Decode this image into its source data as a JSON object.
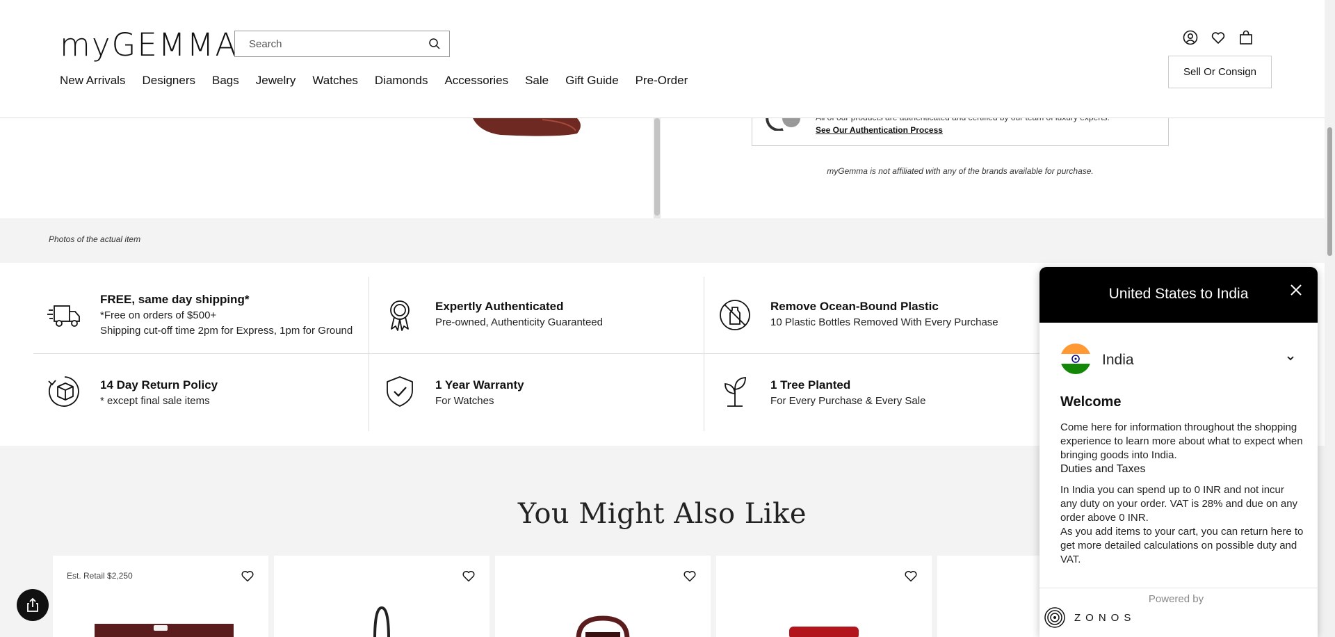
{
  "header": {
    "logo": "myGEMMA",
    "search_placeholder": "Search",
    "nav": [
      "New Arrivals",
      "Designers",
      "Bags",
      "Jewelry",
      "Watches",
      "Diamonds",
      "Accessories",
      "Sale",
      "Gift Guide",
      "Pre-Order"
    ],
    "icons": [
      "account-icon",
      "wishlist-heart-icon",
      "shopping-bag-icon"
    ],
    "sell_button": "Sell Or Consign"
  },
  "product": {
    "auth_text": "All of our products are authenticated and certified by our team of luxury experts.",
    "auth_link": "See Our Authentication Process",
    "affiliation_note": "myGemma is not affiliated with any of the brands available for purchase.",
    "photos_note": "Photos of the actual item"
  },
  "features": [
    {
      "icon": "truck-icon",
      "title": "FREE, same day shipping*",
      "lines": [
        "*Free on orders of $500+",
        "Shipping cut-off time 2pm for Express, 1pm for Ground"
      ]
    },
    {
      "icon": "ribbon-award-icon",
      "title": "Expertly Authenticated",
      "lines": [
        "Pre-owned, Authenticity Guaranteed"
      ]
    },
    {
      "icon": "no-plastic-bottle-icon",
      "title": "Remove Ocean-Bound Plastic",
      "lines": [
        "10 Plastic Bottles Removed With Every Purchase"
      ]
    },
    {
      "icon": "return-box-icon",
      "title": "14 Day Return Policy",
      "lines": [
        "* except final sale items"
      ]
    },
    {
      "icon": "shield-check-icon",
      "title": "1 Year Warranty",
      "lines": [
        "For Watches"
      ]
    },
    {
      "icon": "sprout-icon",
      "title": "1 Tree Planted",
      "lines": [
        "For Every Purchase & Every Sale"
      ]
    }
  ],
  "recommendations": {
    "heading": "You Might Also Like",
    "cards": [
      {
        "retail": "Est. Retail $2,250"
      },
      {
        "retail": ""
      },
      {
        "retail": ""
      },
      {
        "retail": ""
      },
      {
        "retail": ""
      }
    ]
  },
  "popup": {
    "title": "United States to India",
    "country": "India",
    "welcome": "Welcome",
    "welcome_text": "Come here for information throughout the shopping experience to learn more about what to expect when bringing goods into India.",
    "duties_heading": "Duties and Taxes",
    "duties_text": "In India you can spend up to 0 INR and not incur any duty on your order. VAT is 28% and due on any order above 0 INR.",
    "cart_text": "As you add items to your cart, you can return here to get more detailed calculations on possible duty and VAT.",
    "powered_by": "Powered by",
    "brand": "ZONOS"
  },
  "colors": {
    "popup_header": "#000000",
    "section_bg": "#f3f3f3",
    "flag_saffron": "#ff9933",
    "flag_green": "#138808",
    "flag_chakra": "#000080"
  }
}
